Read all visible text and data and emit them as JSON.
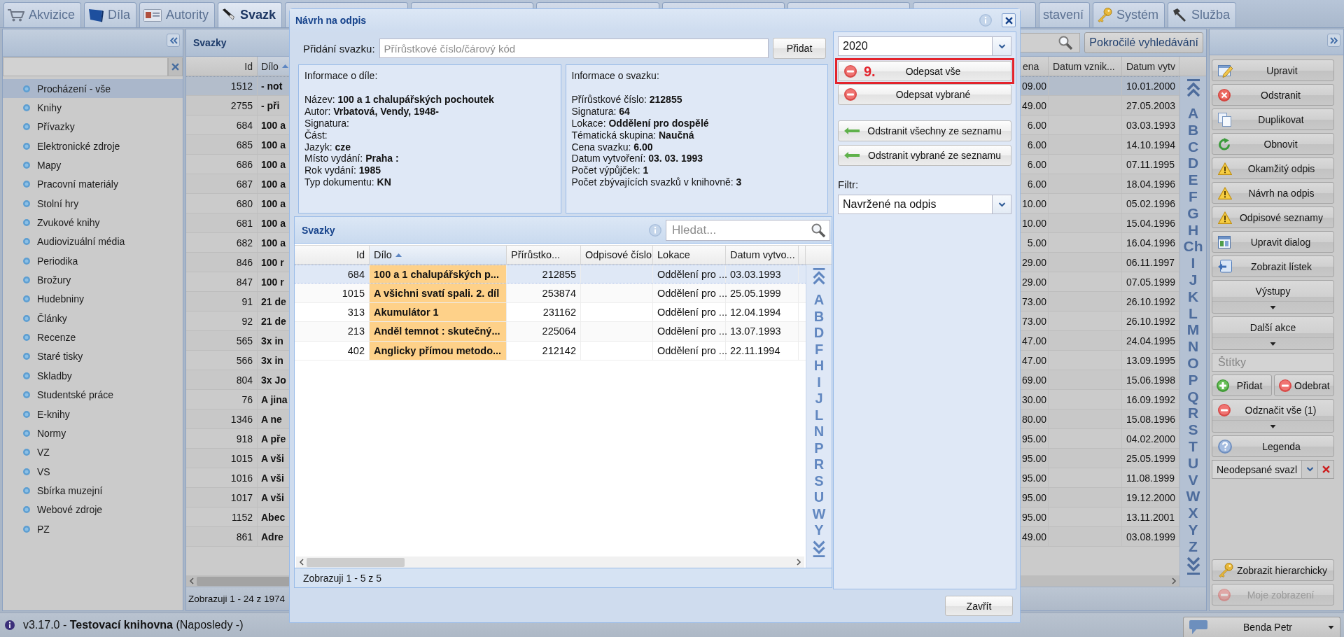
{
  "tabs": [
    {
      "label": "Akvizice",
      "kind": "cart",
      "selected": false
    },
    {
      "label": "Díla",
      "kind": "book",
      "selected": false
    },
    {
      "label": "Autority",
      "kind": "card",
      "selected": false
    },
    {
      "label": "Svazk",
      "kind": "pen",
      "selected": true
    },
    {
      "kind": "covered",
      "selected": false
    },
    {
      "kind": "covered",
      "selected": false
    },
    {
      "kind": "covered",
      "selected": false
    },
    {
      "kind": "covered",
      "selected": false
    },
    {
      "kind": "covered",
      "selected": false
    },
    {
      "kind": "covered",
      "selected": false
    },
    {
      "label": "stavení",
      "kind": "covered",
      "selected": false
    },
    {
      "label": "Systém",
      "kind": "key",
      "selected": false
    },
    {
      "label": "Služba",
      "kind": "hammer",
      "selected": false
    }
  ],
  "sidebar": {
    "items": [
      {
        "label": "Procházení - vše",
        "selected": true
      },
      {
        "label": "Knihy",
        "selected": false
      },
      {
        "label": "Přívazky",
        "selected": false
      },
      {
        "label": "Elektronické zdroje",
        "selected": false
      },
      {
        "label": "Mapy",
        "selected": false
      },
      {
        "label": "Pracovní materiály",
        "selected": false
      },
      {
        "label": "Stolní hry",
        "selected": false
      },
      {
        "label": "Zvukové knihy",
        "selected": false
      },
      {
        "label": "Audiovizuální média",
        "selected": false
      },
      {
        "label": "Periodika",
        "selected": false
      },
      {
        "label": "Brožury",
        "selected": false
      },
      {
        "label": "Hudebniny",
        "selected": false
      },
      {
        "label": "Články",
        "selected": false
      },
      {
        "label": "Recenze",
        "selected": false
      },
      {
        "label": "Staré tisky",
        "selected": false
      },
      {
        "label": "Skladby",
        "selected": false
      },
      {
        "label": "Studentské práce",
        "selected": false
      },
      {
        "label": "E-knihy",
        "selected": false
      },
      {
        "label": "Normy",
        "selected": false
      },
      {
        "label": "VZ",
        "selected": false
      },
      {
        "label": "VS",
        "selected": false
      },
      {
        "label": "Sbírka muzejní",
        "selected": false
      },
      {
        "label": "Webové zdroje",
        "selected": false
      },
      {
        "label": "PZ",
        "selected": false
      }
    ]
  },
  "volumes": {
    "title": "Svazky",
    "advanced_search": "Pokročilé vyhledávání",
    "columns": [
      {
        "label": "Id",
        "sorted": false
      },
      {
        "label": "Dílo",
        "sorted": true
      },
      {
        "label": "ena",
        "sorted": false
      },
      {
        "label": "Datum vznik...",
        "sorted": false
      },
      {
        "label": "Datum vytv",
        "sorted": false
      }
    ],
    "rows": [
      {
        "id": "1512",
        "work": "- not",
        "price": "09.00",
        "date": "10.01.2000",
        "selected": true
      },
      {
        "id": "2755",
        "work": "- při",
        "price": "49.00",
        "date": "27.05.2003",
        "selected": false
      },
      {
        "id": "684",
        "work": "100 a",
        "price": "6.00",
        "date": "03.03.1993",
        "selected": false
      },
      {
        "id": "685",
        "work": "100 a",
        "price": "6.00",
        "date": "14.10.1994",
        "selected": false
      },
      {
        "id": "686",
        "work": "100 a",
        "price": "6.00",
        "date": "07.11.1995",
        "selected": false
      },
      {
        "id": "687",
        "work": "100 a",
        "price": "6.00",
        "date": "18.04.1996",
        "selected": false
      },
      {
        "id": "680",
        "work": "100 a",
        "price": "10.00",
        "date": "05.02.1996",
        "selected": false
      },
      {
        "id": "681",
        "work": "100 a",
        "price": "10.00",
        "date": "15.04.1996",
        "selected": false
      },
      {
        "id": "682",
        "work": "100 a",
        "price": "5.00",
        "date": "16.04.1996",
        "selected": false
      },
      {
        "id": "846",
        "work": "100 r",
        "price": "29.00",
        "date": "06.11.1997",
        "selected": false
      },
      {
        "id": "847",
        "work": "100 r",
        "price": "29.00",
        "date": "07.05.1999",
        "selected": false
      },
      {
        "id": "91",
        "work": "21 de",
        "price": "73.00",
        "date": "26.10.1992",
        "selected": false
      },
      {
        "id": "92",
        "work": "21 de",
        "price": "73.00",
        "date": "26.10.1992",
        "selected": false
      },
      {
        "id": "565",
        "work": "3x in",
        "price": "47.00",
        "date": "24.04.1995",
        "selected": false
      },
      {
        "id": "566",
        "work": "3x in",
        "price": "47.00",
        "date": "13.09.1995",
        "selected": false
      },
      {
        "id": "804",
        "work": "3x Jo",
        "price": "69.00",
        "date": "15.06.1998",
        "selected": false
      },
      {
        "id": "76",
        "work": "A jina",
        "price": "30.00",
        "date": "16.09.1992",
        "selected": false
      },
      {
        "id": "1346",
        "work": "A ne",
        "price": "80.00",
        "date": "15.08.1996",
        "selected": false
      },
      {
        "id": "918",
        "work": "A pře",
        "price": "95.00",
        "date": "04.02.2000",
        "selected": false
      },
      {
        "id": "1015",
        "work": "A vši",
        "price": "95.00",
        "date": "25.05.1999",
        "selected": false
      },
      {
        "id": "1016",
        "work": "A vši",
        "price": "95.00",
        "date": "11.08.1999",
        "selected": false
      },
      {
        "id": "1017",
        "work": "A vši",
        "price": "95.00",
        "date": "19.12.2000",
        "selected": false
      },
      {
        "id": "1152",
        "work": "Abec",
        "price": "95.00",
        "date": "13.11.2001",
        "selected": false
      },
      {
        "id": "861",
        "work": "Adre",
        "price": "49.00",
        "date": "03.08.1999",
        "selected": false
      }
    ],
    "letters": [
      "A",
      "B",
      "C",
      "D",
      "E",
      "F",
      "G",
      "H",
      "Ch",
      "I",
      "J",
      "K",
      "L",
      "M",
      "N",
      "O",
      "P",
      "Q",
      "R",
      "S",
      "T",
      "U",
      "V",
      "W",
      "X",
      "Y",
      "Z"
    ],
    "paging": "Zobrazuji 1 - 24 z 1974"
  },
  "side_panel": {
    "actions": [
      {
        "kind": "edit",
        "label": "Upravit"
      },
      {
        "kind": "delete",
        "label": "Odstranit"
      },
      {
        "kind": "duplicate",
        "label": "Duplikovat"
      },
      {
        "kind": "refresh",
        "label": "Obnovit"
      },
      {
        "kind": "warning",
        "label": "Okamžitý odpis"
      },
      {
        "kind": "warning",
        "label": "Návrh na odpis"
      },
      {
        "kind": "warning",
        "label": "Odpisové seznamy"
      },
      {
        "kind": "form",
        "label": "Upravit dialog"
      },
      {
        "kind": "card",
        "label": "Zobrazit lístek"
      },
      {
        "kind": "menu",
        "label": "Výstupy"
      },
      {
        "kind": "menu",
        "label": "Další akce"
      }
    ],
    "tags": {
      "placeholder": "Štítky"
    },
    "tag_buttons": [
      {
        "kind": "add",
        "label": "Přidat"
      },
      {
        "kind": "remove",
        "label": "Odebrat"
      }
    ],
    "unmark": "Odznačit vše (1)",
    "legend": "Legenda",
    "view": {
      "value": "Neodepsané svazl"
    },
    "bottom_actions": [
      {
        "kind": "key",
        "label": "Zobrazit hierarchicky",
        "disabled": false
      },
      {
        "kind": "remove",
        "label": "Moje zobrazení",
        "disabled": true
      }
    ]
  },
  "status_bar": {
    "text": "v3.17.0 - **Testovací knihovna** (Naposledy -)",
    "user": "Benda Petr"
  },
  "dialog": {
    "title": "Návrh na odpis",
    "add_label": "Přidání svazku:",
    "add_field": {
      "placeholder": "Přírůstkové číslo/čárový kód"
    },
    "add_button": "Přidat",
    "info_panels": [
      {
        "heading": "Informace o díle:",
        "lines": [
          {
            "label": "Název:",
            "value": "100 a 1 chalupářských pochoutek"
          },
          {
            "label": "Autor:",
            "value": "Vrbatová, Vendy, 1948-"
          },
          {
            "label": "Signatura:"
          },
          {
            "label": "Část:"
          },
          {
            "label": "Jazyk:",
            "value": "cze"
          },
          {
            "label": "Místo vydání:",
            "value": "Praha :"
          },
          {
            "label": "Rok vydání:",
            "value": "1985"
          },
          {
            "label": "Typ dokumentu:",
            "value": "KN"
          }
        ]
      },
      {
        "heading": "Informace o svazku:",
        "lines": [
          {
            "label": "Přírůstkové číslo:",
            "value": "212855"
          },
          {
            "label": "Signatura:",
            "value": "64"
          },
          {
            "label": "Lokace:",
            "value": "Oddělení pro dospělé"
          },
          {
            "label": "Tématická skupina:",
            "value": "Naučná"
          },
          {
            "label": "Cena svazku:",
            "value": "6.00"
          },
          {
            "label": "Datum vytvoření:",
            "value": "03. 03. 1993"
          },
          {
            "label": "Počet výpůjček:",
            "value": "1"
          },
          {
            "label": "Počet zbývajících svazků v knihovně:",
            "value": "3"
          }
        ]
      }
    ],
    "grid": {
      "title": "Svazky",
      "search": {
        "placeholder": "Hledat..."
      },
      "columns": [
        {
          "label": "Id",
          "sorted": false
        },
        {
          "label": "Dílo",
          "sorted": true
        },
        {
          "label": "Přírůstko...",
          "sorted": false
        },
        {
          "label": "Odpisové číslo",
          "sorted": false
        },
        {
          "label": "Lokace",
          "sorted": false
        },
        {
          "label": "Datum vytvo...",
          "sorted": false
        }
      ],
      "rows": [
        {
          "id": "684",
          "work": "100 a 1 chalupářských p...",
          "accession": "212855",
          "location": "Oddělení pro ...",
          "date": "03.03.1993",
          "selected": true
        },
        {
          "id": "1015",
          "work": "A všichni svatí spali. 2. díl",
          "accession": "253874",
          "location": "Oddělení pro ...",
          "date": "25.05.1999",
          "selected": false
        },
        {
          "id": "313",
          "work": "Akumulátor 1",
          "accession": "231162",
          "location": "Oddělení pro ...",
          "date": "12.04.1994",
          "selected": false
        },
        {
          "id": "213",
          "work": "Anděl temnot : skutečný...",
          "accession": "225064",
          "location": "Oddělení pro ...",
          "date": "13.07.1993",
          "selected": false
        },
        {
          "id": "402",
          "work": "Anglicky přímou metodo...",
          "accession": "212142",
          "location": "Oddělení pro ...",
          "date": "22.11.1994",
          "selected": false
        }
      ],
      "letters": [
        "A",
        "B",
        "D",
        "F",
        "H",
        "I",
        "J",
        "L",
        "N",
        "P",
        "R",
        "S",
        "U",
        "W",
        "Y"
      ],
      "paging": "Zobrazuji 1 - 5 z 5"
    },
    "year": {
      "value": "2020"
    },
    "actions": [
      {
        "kind": "writeoff",
        "label": "Odepsat vše",
        "highlighted": true,
        "step": "9."
      },
      {
        "kind": "writeoff",
        "label": "Odepsat vybrané",
        "highlighted": false
      },
      {
        "kind": "unlist",
        "label": "Odstranit všechny ze seznamu",
        "highlighted": false
      },
      {
        "kind": "unlist",
        "label": "Odstranit vybrané ze seznamu",
        "highlighted": false
      }
    ],
    "filter_label": "Filtr:",
    "filter": {
      "value": "Navržené na odpis"
    },
    "close_button": "Zavřít"
  }
}
